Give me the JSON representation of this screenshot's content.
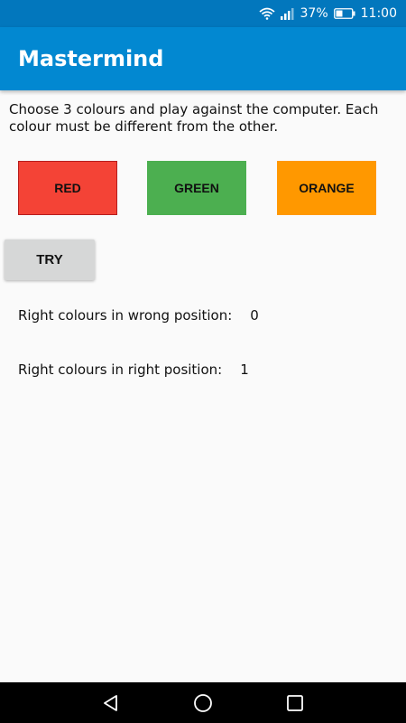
{
  "status_bar": {
    "battery_percent": "37%",
    "time": "11:00",
    "icons": [
      "wifi-icon",
      "signal-icon",
      "battery-icon"
    ]
  },
  "app_bar": {
    "title": "Mastermind",
    "color": "#0288d1"
  },
  "main": {
    "instructions": "Choose 3 colours and play against the computer. Each colour must be different from the other.",
    "color_buttons": [
      {
        "label": "RED",
        "color": "#f44336"
      },
      {
        "label": "GREEN",
        "color": "#4caf50"
      },
      {
        "label": "ORANGE",
        "color": "#ff9800"
      }
    ],
    "try_label": "TRY",
    "results": {
      "wrong_position_label": "Right colours in wrong position:",
      "wrong_position_value": "0",
      "right_position_label": "Right colours in right position:",
      "right_position_value": "1"
    }
  },
  "nav_bar": {
    "icons": [
      "back-icon",
      "home-icon",
      "recents-icon"
    ]
  }
}
